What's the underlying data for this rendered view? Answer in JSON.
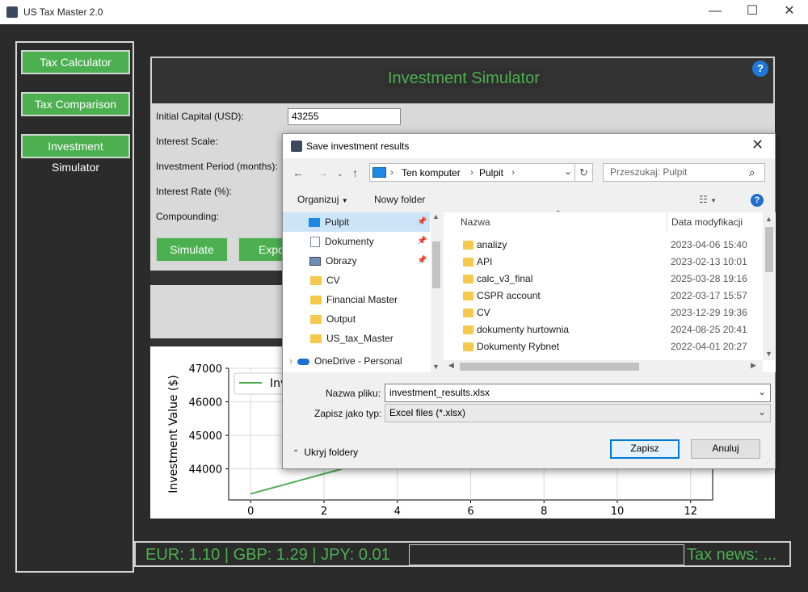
{
  "window": {
    "title": "US Tax Master 2.0",
    "controls": [
      "—",
      "☐",
      "✕"
    ]
  },
  "sidebar": {
    "items": [
      {
        "label": "Tax Calculator"
      },
      {
        "label": "Tax Comparison"
      },
      {
        "label": "Investment Simulator"
      }
    ]
  },
  "main": {
    "title": "Investment Simulator",
    "help": "?",
    "fields": [
      {
        "label": "Initial Capital (USD):",
        "value": "43255"
      },
      {
        "label": "Interest Scale:"
      },
      {
        "label": "Investment Period (months):"
      },
      {
        "label": "Interest Rate (%):"
      },
      {
        "label": "Compounding:"
      }
    ],
    "simulate_label": "Simulate",
    "export_label": "Expo",
    "accent": "#4caf50"
  },
  "chart_data": {
    "type": "line",
    "ylabel": "Investment Value ($)",
    "xlabel": "",
    "x_ticks": [
      "0",
      "2",
      "4",
      "6",
      "8",
      "10",
      "12"
    ],
    "y_ticks": [
      "44000",
      "45000",
      "46000",
      "47000"
    ],
    "ylim_visible": [
      43255,
      47000
    ],
    "series": [
      {
        "name": "Inv",
        "color": "#4caf50",
        "x": [
          0,
          2.5
        ],
        "y": [
          43255,
          44000
        ]
      }
    ],
    "legend": "top-left"
  },
  "ticker": {
    "rates": "EUR: 1.10 | GBP: 1.29 | JPY: 0.01",
    "news": "Tax news: ..."
  },
  "dialog": {
    "title": "Save investment results",
    "breadcrumb": [
      "Ten komputer",
      "Pulpit"
    ],
    "search_placeholder": "Przeszukaj: Pulpit",
    "toolbar": {
      "organize": "Organizuj",
      "new_folder": "Nowy folder"
    },
    "nav": [
      {
        "label": "Pulpit",
        "selected": true,
        "icon": "desktop-icon"
      },
      {
        "label": "Dokumenty",
        "icon": "documents-icon"
      },
      {
        "label": "Obrazy",
        "icon": "pictures-icon"
      },
      {
        "label": "CV",
        "icon": "folder-icon"
      },
      {
        "label": "Financial Master",
        "icon": "folder-icon"
      },
      {
        "label": "Output",
        "icon": "folder-icon"
      },
      {
        "label": "US_tax_Master",
        "icon": "folder-icon"
      },
      {
        "label": "OneDrive - Personal",
        "icon": "cloud-icon"
      }
    ],
    "columns": {
      "name": "Nazwa",
      "date": "Data modyfikacji"
    },
    "files": [
      {
        "name": "analizy",
        "date": "2023-04-06 15:40"
      },
      {
        "name": "API",
        "date": "2023-02-13 10:01"
      },
      {
        "name": "calc_v3_final",
        "date": "2025-03-28 19:16"
      },
      {
        "name": "CSPR account",
        "date": "2022-03-17 15:57"
      },
      {
        "name": "CV",
        "date": "2023-12-29 19:36"
      },
      {
        "name": "dokumenty hurtownia",
        "date": "2024-08-25 20:41"
      },
      {
        "name": "Dokumenty Rybnet",
        "date": "2022-04-01 20:27"
      }
    ],
    "filename_label": "Nazwa pliku:",
    "filename_value": "investment_results.xlsx",
    "filetype_label": "Zapisz jako typ:",
    "filetype_value": "Excel files (*.xlsx)",
    "hide_folders": "Ukryj foldery",
    "save": "Zapisz",
    "cancel": "Anuluj"
  }
}
